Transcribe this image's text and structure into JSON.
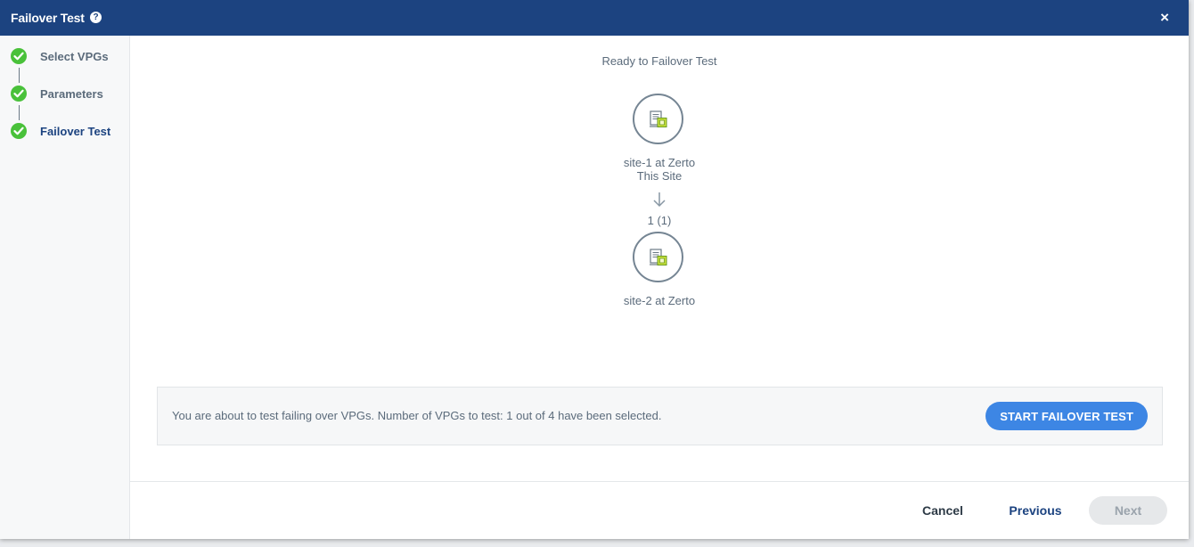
{
  "dialog": {
    "title": "Failover Test",
    "help_icon": "question-circle-icon",
    "close_icon": "close-icon",
    "close_label": "×",
    "help_label": "?"
  },
  "steps": [
    {
      "label": "Select VPGs",
      "status": "complete",
      "icon": "check-circle-icon"
    },
    {
      "label": "Parameters",
      "status": "complete",
      "icon": "check-circle-icon"
    },
    {
      "label": "Failover Test",
      "status": "active",
      "icon": "check-circle-icon"
    }
  ],
  "topology": {
    "heading": "Ready to Failover Test",
    "source": {
      "name": "site-1 at Zerto",
      "sublabel": "This Site",
      "icon": "site-server-icon"
    },
    "arrow_icon": "arrow-down-icon",
    "count_label": "1 (1)",
    "target": {
      "name": "site-2 at Zerto",
      "icon": "site-server-icon"
    }
  },
  "summary": {
    "text": "You are about to test failing over VPGs. Number of VPGs to test: 1 out of 4 have been selected.",
    "start_button": "START FAILOVER TEST"
  },
  "footer": {
    "cancel": "Cancel",
    "previous": "Previous",
    "next": "Next"
  },
  "colors": {
    "header": "#1c4380",
    "check": "#49c13a",
    "primary_button": "#3d86e4"
  }
}
